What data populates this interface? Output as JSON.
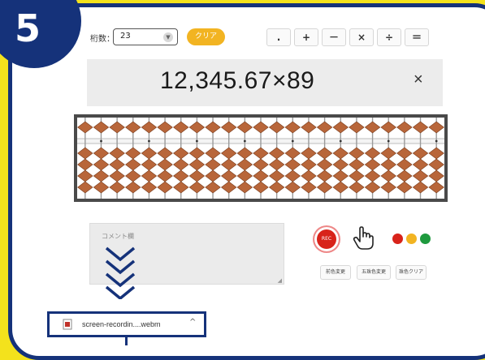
{
  "step": {
    "number": "5"
  },
  "toolbar": {
    "digits_label": "桁数：",
    "digits_value": "23",
    "clear_label": "クリア",
    "operators": [
      ".",
      "+",
      "－",
      "×",
      "÷",
      "＝"
    ]
  },
  "display": {
    "expression": "12,345.67×89",
    "close_symbol": "×"
  },
  "abacus": {
    "rods": 23,
    "bead_color": "#b8663a",
    "frame_color": "#4a4a4a"
  },
  "comment": {
    "placeholder": "コメント欄"
  },
  "controls": {
    "rec_label": "REC",
    "dot_colors": [
      "#d8231a",
      "#f2b422",
      "#1e9a3e"
    ],
    "buttons": [
      "前色変更",
      "五珠色変更",
      "珠色クリア"
    ]
  },
  "download": {
    "filename": "screen-recordin....webm"
  },
  "colors": {
    "accent_navy": "#15327a",
    "background_yellow": "#f3e21c",
    "clear_orange": "#f2b422"
  }
}
